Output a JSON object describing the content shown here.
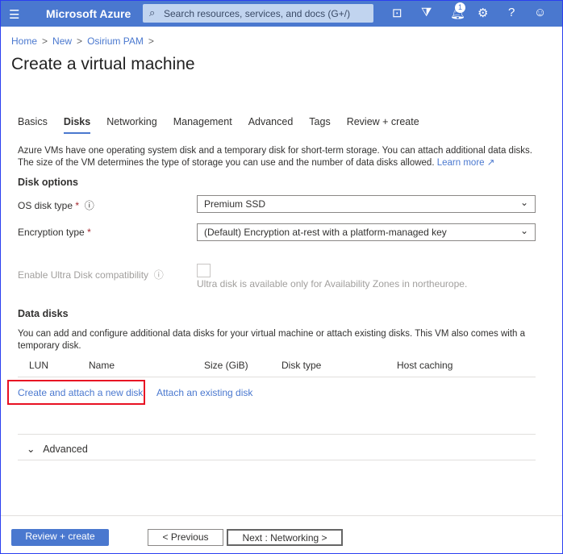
{
  "topbar": {
    "brand": "Microsoft Azure",
    "search_placeholder": "Search resources, services, and docs (G+/)",
    "notification_count": "1"
  },
  "breadcrumb": [
    "Home",
    "New",
    "Osirium PAM"
  ],
  "page_title": "Create a virtual machine",
  "tabs": [
    "Basics",
    "Disks",
    "Networking",
    "Management",
    "Advanced",
    "Tags",
    "Review + create"
  ],
  "active_tab": "Disks",
  "description": "Azure VMs have one operating system disk and a temporary disk for short-term storage. You can attach additional data disks. The size of the VM determines the type of storage you can use and the number of data disks allowed.",
  "learn_more": "Learn more",
  "disk_options": {
    "heading": "Disk options",
    "os_disk_label": "OS disk type",
    "os_disk_value": "Premium SSD",
    "encryption_label": "Encryption type",
    "encryption_value": "(Default) Encryption at-rest with a platform-managed key",
    "ultra_label": "Enable Ultra Disk compatibility",
    "ultra_note": "Ultra disk is available only for Availability Zones in northeurope."
  },
  "data_disks": {
    "heading": "Data disks",
    "description": "You can add and configure additional data disks for your virtual machine or attach existing disks. This VM also comes with a temporary disk.",
    "columns": [
      "LUN",
      "Name",
      "Size (GiB)",
      "Disk type",
      "Host caching"
    ],
    "create_link": "Create and attach a new disk",
    "attach_link": "Attach an existing disk"
  },
  "advanced_section": "Advanced",
  "footer": {
    "review": "Review + create",
    "previous": "< Previous",
    "next": "Next : Networking >"
  },
  "colors": {
    "accent": "#4a78cf",
    "highlight": "#e81123"
  }
}
